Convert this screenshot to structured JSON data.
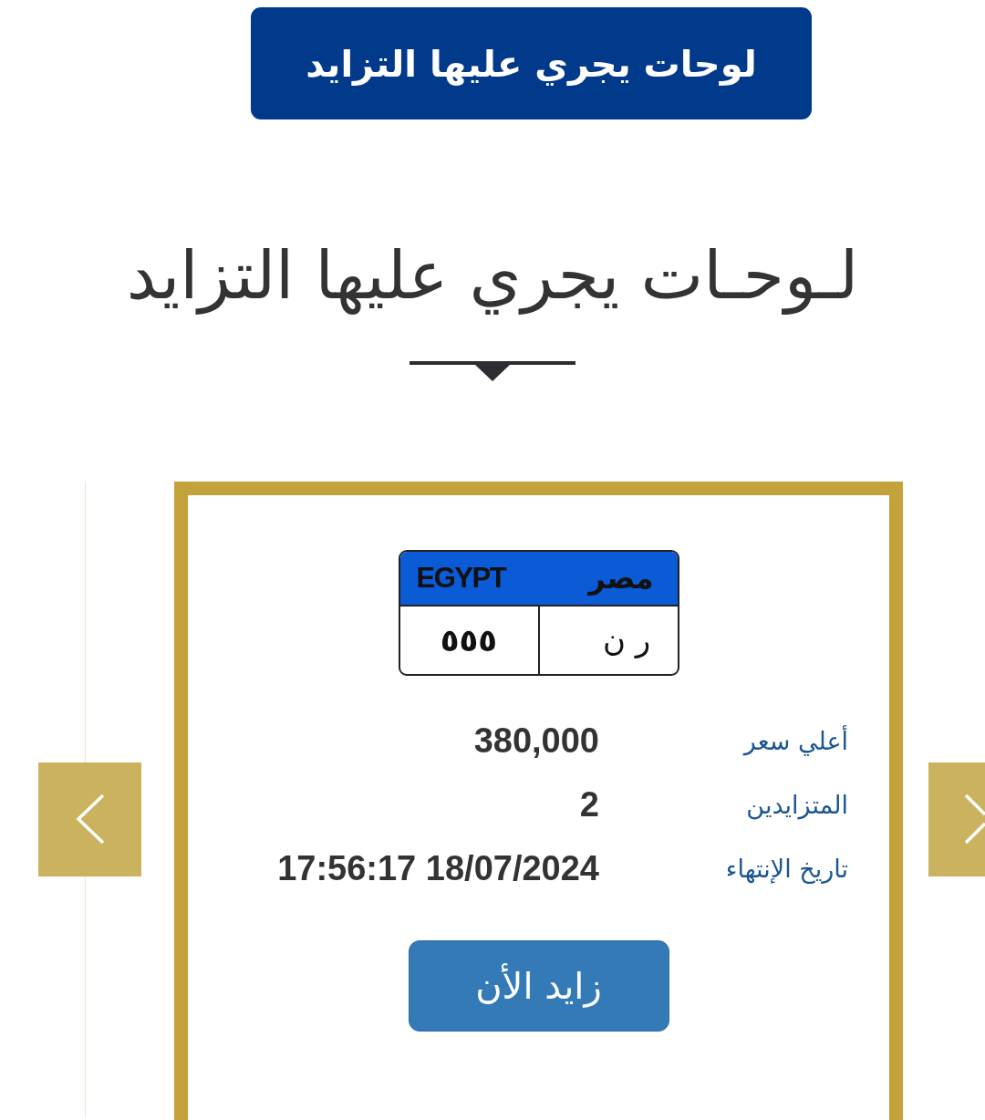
{
  "header_button": {
    "label": "لوحات يجري عليها التزايد"
  },
  "section": {
    "title": "لـوحـات يجري عليها التزايد"
  },
  "carousel": {
    "card": {
      "plate": {
        "country_ar": "مصر",
        "country_en": "EGYPT",
        "letters": "ر ن",
        "numbers": "٥٥٥"
      },
      "details": [
        {
          "label": "أعلي سعر",
          "value": "380,000"
        },
        {
          "label": "المتزايدين",
          "value": "2"
        },
        {
          "label": "تاريخ الإنتهاء",
          "value": "17:56:17 18/07/2024"
        }
      ],
      "bid_button": "زايد الأن"
    }
  }
}
